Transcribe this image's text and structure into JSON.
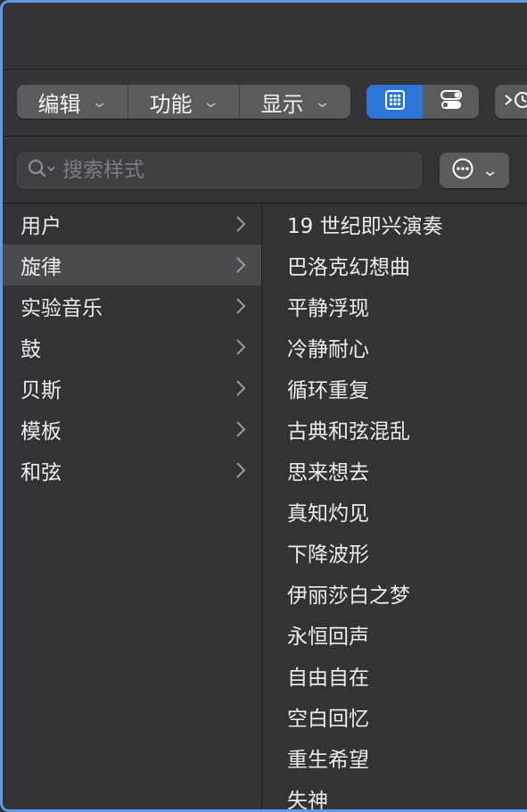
{
  "toolbar": {
    "edit_label": "编辑",
    "function_label": "功能",
    "display_label": "显示"
  },
  "search": {
    "placeholder": "搜索样式"
  },
  "categories": [
    {
      "label": "用户"
    },
    {
      "label": "旋律",
      "selected": true
    },
    {
      "label": "实验音乐"
    },
    {
      "label": "鼓"
    },
    {
      "label": "贝斯"
    },
    {
      "label": "模板"
    },
    {
      "label": "和弦"
    }
  ],
  "styles": [
    "19 世纪即兴演奏",
    "巴洛克幻想曲",
    "平静浮现",
    "冷静耐心",
    "循环重复",
    "古典和弦混乱",
    "思来想去",
    "真知灼见",
    "下降波形",
    "伊丽莎白之梦",
    "永恒回声",
    "自由自在",
    "空白回忆",
    "重生希望",
    "失神"
  ],
  "colors": {
    "accent": "#2c75d6",
    "window_border": "#5e9ae6"
  }
}
